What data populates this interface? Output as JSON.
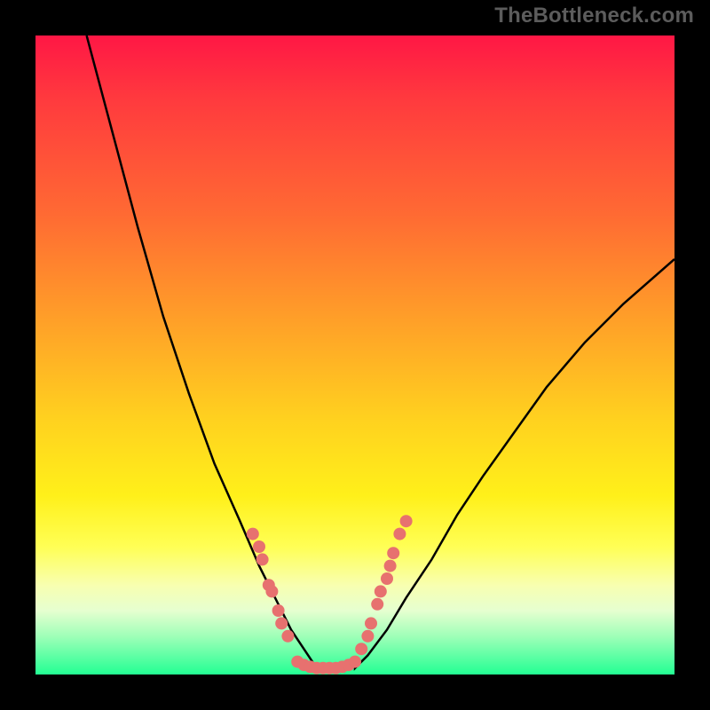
{
  "watermark": "TheBottleneck.com",
  "chart_data": {
    "type": "line",
    "title": "",
    "xlabel": "",
    "ylabel": "",
    "xlim": [
      0,
      100
    ],
    "ylim": [
      0,
      100
    ],
    "grid": false,
    "legend": false,
    "annotations": [],
    "curve_left": {
      "description": "Left descending branch of bottleneck V-curve",
      "x": [
        8,
        12,
        16,
        20,
        24,
        28,
        32,
        35,
        38,
        40,
        42,
        44
      ],
      "y": [
        100,
        85,
        70,
        56,
        44,
        33,
        24,
        17,
        11,
        7,
        4,
        1
      ]
    },
    "curve_right": {
      "description": "Right ascending branch of bottleneck V-curve",
      "x": [
        50,
        52,
        55,
        58,
        62,
        66,
        70,
        75,
        80,
        86,
        92,
        100
      ],
      "y": [
        1,
        3,
        7,
        12,
        18,
        25,
        31,
        38,
        45,
        52,
        58,
        65
      ]
    },
    "dots_left": {
      "description": "Pink markers on left branch",
      "x": [
        34,
        35,
        35.5,
        36.5,
        37,
        38,
        38.5,
        39.5
      ],
      "y": [
        22,
        20,
        18,
        14,
        13,
        10,
        8,
        6
      ]
    },
    "dots_right": {
      "description": "Pink markers on right branch",
      "x": [
        51,
        52,
        52.5,
        53.5,
        54,
        55,
        55.5,
        56,
        57,
        58
      ],
      "y": [
        4,
        6,
        8,
        11,
        13,
        15,
        17,
        19,
        22,
        24
      ]
    },
    "dots_bottom": {
      "description": "Pink markers along flat valley bottom",
      "x": [
        41,
        42,
        43,
        44,
        45,
        46,
        47,
        48,
        49,
        50
      ],
      "y": [
        2,
        1.5,
        1.2,
        1,
        1,
        1,
        1,
        1.2,
        1.5,
        2
      ]
    },
    "colors": {
      "curve": "#000000",
      "dots": "#e7716f",
      "background_top": "#ff1745",
      "background_bottom": "#23ff93",
      "frame": "#000000"
    }
  }
}
